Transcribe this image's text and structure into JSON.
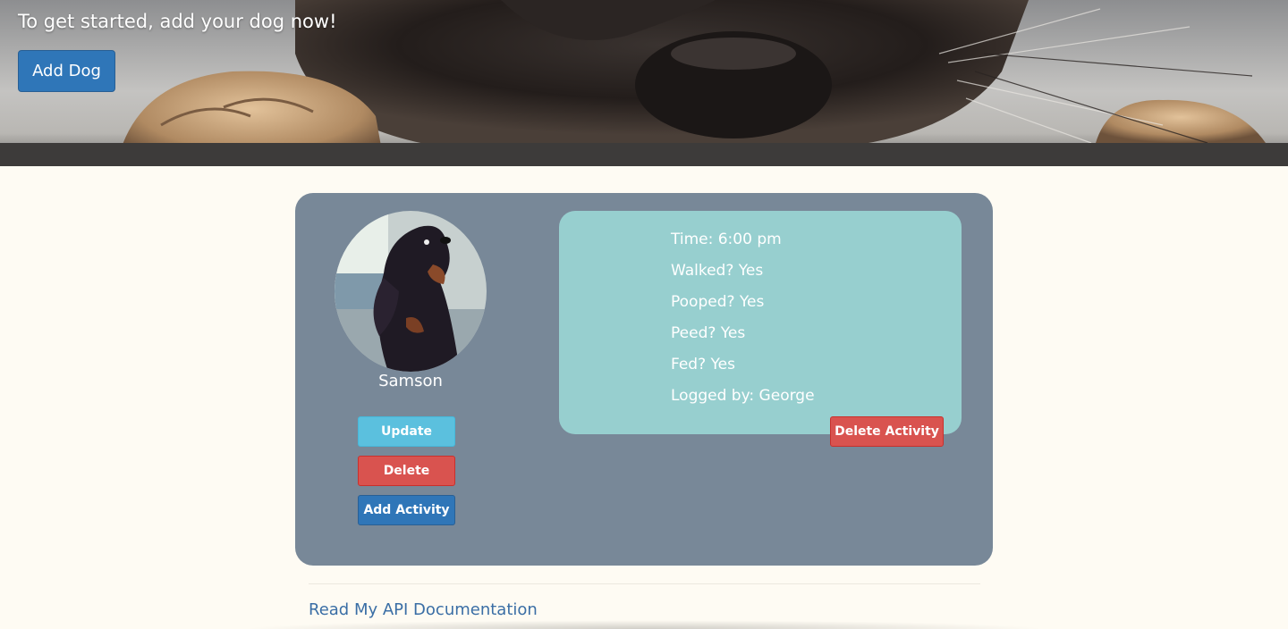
{
  "hero": {
    "headline": "To get started, add your dog now!",
    "add_dog_label": "Add Dog"
  },
  "dog": {
    "name": "Samson",
    "update_label": "Update",
    "delete_label": "Delete",
    "add_activity_label": "Add Activity"
  },
  "activity": {
    "time": "Time: 6:00 pm",
    "walked": "Walked? Yes",
    "pooped": "Pooped? Yes",
    "peed": "Peed? Yes",
    "fed": "Fed? Yes",
    "logged_by": "Logged by: George",
    "delete_label": "Delete Activity"
  },
  "footer": {
    "api_link": "Read My API Documentation"
  },
  "colors": {
    "page_bg": "#fefbf3",
    "card_bg": "#788898",
    "activity_bg": "#97cfcf",
    "primary": "#2f76b8",
    "info": "#5bc0de",
    "danger": "#d9534f",
    "link": "#3a6ea5"
  }
}
